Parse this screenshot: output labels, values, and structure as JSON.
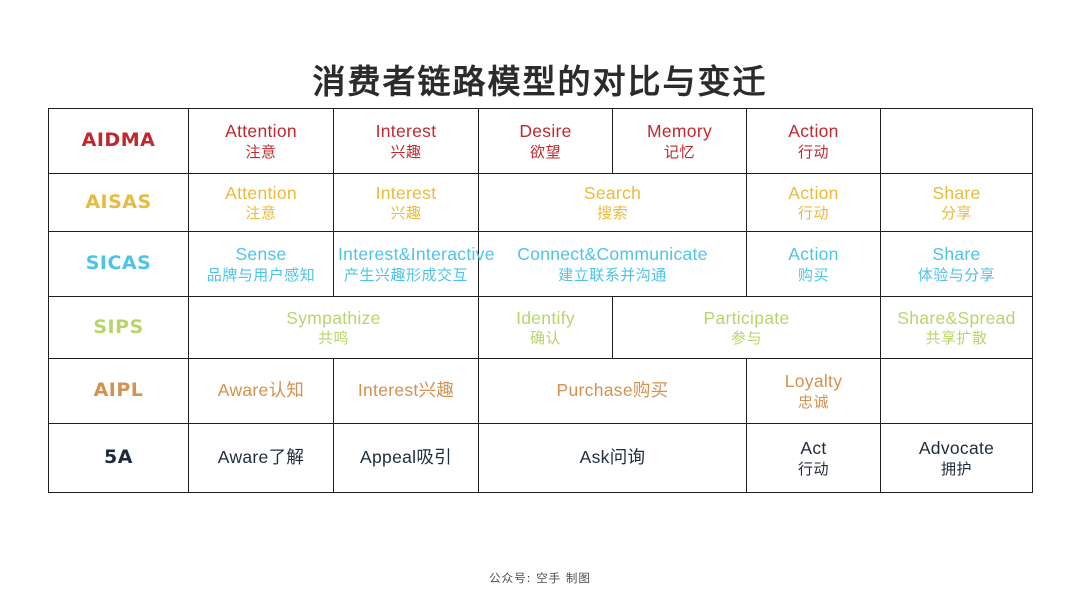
{
  "page": {
    "title": "消费者链路模型的对比与变迁",
    "footer_credit": "公众号: 空手  制图",
    "background": "#ffffff",
    "border_color": "#1d1d1d",
    "title_color": "#2b2b2b"
  },
  "colors": {
    "aidma": "#c0282d",
    "aisas": "#e8bb3c",
    "sicas": "#4ec3e8",
    "sips": "#b8d56b",
    "aipl": "#d4914f",
    "5a": "#1e2b3c"
  },
  "table": {
    "columns": 7,
    "rows": [
      {
        "key": "aidma",
        "label": "AIDMA",
        "color": "#c0282d",
        "cells": [
          {
            "en": "Attention",
            "cn": "注意",
            "span": 1
          },
          {
            "en": "Interest",
            "cn": "兴趣",
            "span": 1
          },
          {
            "en": "Desire",
            "cn": "欲望",
            "span": 1
          },
          {
            "en": "Memory",
            "cn": "记忆",
            "span": 1
          },
          {
            "en": "Action",
            "cn": "行动",
            "span": 1
          },
          {
            "en": "",
            "cn": "",
            "span": 1
          }
        ]
      },
      {
        "key": "aisas",
        "label": "AISAS",
        "color": "#e8bb3c",
        "cells": [
          {
            "en": "Attention",
            "cn": "注意",
            "span": 1
          },
          {
            "en": "Interest",
            "cn": "兴趣",
            "span": 1
          },
          {
            "en": "Search",
            "cn": "搜索",
            "span": 2
          },
          {
            "en": "Action",
            "cn": "行动",
            "span": 1
          },
          {
            "en": "Share",
            "cn": "分享",
            "span": 1
          }
        ]
      },
      {
        "key": "sicas",
        "label": "SICAS",
        "color": "#4ec3e8",
        "cells": [
          {
            "en": "Sense",
            "cn": "品牌与用户感知",
            "span": 1
          },
          {
            "en": "Interest&Interactive",
            "cn": "产生兴趣形成交互",
            "span": 1
          },
          {
            "en": "Connect&Communicate",
            "cn": "建立联系并沟通",
            "span": 2
          },
          {
            "en": "Action",
            "cn": "购买",
            "span": 1
          },
          {
            "en": "Share",
            "cn": "体验与分享",
            "span": 1
          }
        ]
      },
      {
        "key": "sips",
        "label": "SIPS",
        "color": "#b8d56b",
        "cells": [
          {
            "en": "Sympathize",
            "cn": "共鸣",
            "span": 2
          },
          {
            "en": "Identify",
            "cn": "确认",
            "span": 1
          },
          {
            "en": "Participate",
            "cn": "参与",
            "span": 2
          },
          {
            "en": "Share&Spread",
            "cn": "共享扩散",
            "span": 1
          }
        ]
      },
      {
        "key": "aipl",
        "label": "AIPL",
        "color": "#d4914f",
        "cells": [
          {
            "inline": "Aware认知",
            "span": 1
          },
          {
            "inline": "Interest兴趣",
            "span": 1
          },
          {
            "inline": "Purchase购买",
            "span": 2
          },
          {
            "en": "Loyalty",
            "cn": "忠诚",
            "span": 1
          },
          {
            "en": "",
            "cn": "",
            "span": 1
          }
        ]
      },
      {
        "key": "5a",
        "label": "5A",
        "color": "#1e2b3c",
        "cells": [
          {
            "inline": "Aware了解",
            "span": 1
          },
          {
            "inline": "Appeal吸引",
            "span": 1
          },
          {
            "inline": "Ask问询",
            "span": 2
          },
          {
            "en": "Act",
            "cn": "行动",
            "span": 1
          },
          {
            "en": "Advocate",
            "cn": "拥护",
            "span": 1
          },
          {
            "en": "",
            "cn": "",
            "span": 1
          }
        ]
      }
    ]
  }
}
